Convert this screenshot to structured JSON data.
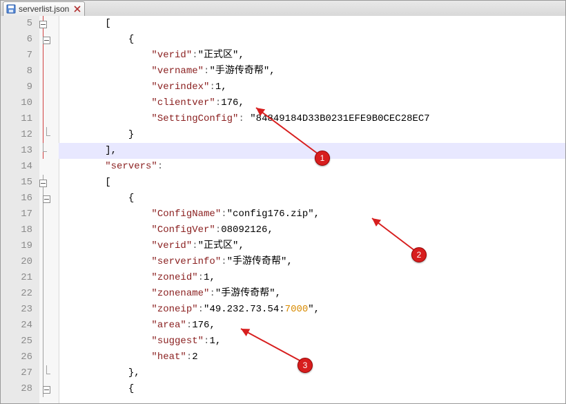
{
  "tab": {
    "filename": "serverlist.json"
  },
  "gutter": {
    "start": 5,
    "end": 28
  },
  "code": {
    "rows": [
      "        [",
      "            {",
      "                \"verid\":\"正式区\",",
      "                \"vername\":\"手游传奇帮\",",
      "                \"verindex\":1,",
      "                \"clientver\":176,",
      "                \"SettingConfig\": \"84849184D33B0231EFE9B0CEC28EC7",
      "            }",
      "        ],",
      "        \"servers\":",
      "        [",
      "            {",
      "                \"ConfigName\":\"config176.zip\",",
      "                \"ConfigVer\":08092126,",
      "                \"verid\":\"正式区\",",
      "                \"serverinfo\":\"手游传奇帮\",",
      "                \"zoneid\":1,",
      "                \"zonename\":\"手游传奇帮\",",
      "                \"zoneip\":\"49.232.73.54:7000\",",
      "                \"area\":176,",
      "                \"suggest\":1,",
      "                \"heat\":2",
      "            },",
      "            {"
    ]
  },
  "annotations": {
    "b1": "1",
    "b2": "2",
    "b3": "3"
  },
  "parsed_json": {
    "block1": {
      "verid": "正式区",
      "vername": "手游传奇帮",
      "verindex": 1,
      "clientver": 176,
      "SettingConfig": "84849184D33B0231EFE9B0CEC28EC7"
    },
    "servers": [
      {
        "ConfigName": "config176.zip",
        "ConfigVer": "08092126",
        "verid": "正式区",
        "serverinfo": "手游传奇帮",
        "zoneid": 1,
        "zonename": "手游传奇帮",
        "zoneip": "49.232.73.54:7000",
        "area": 176,
        "suggest": 1,
        "heat": 2
      }
    ]
  }
}
